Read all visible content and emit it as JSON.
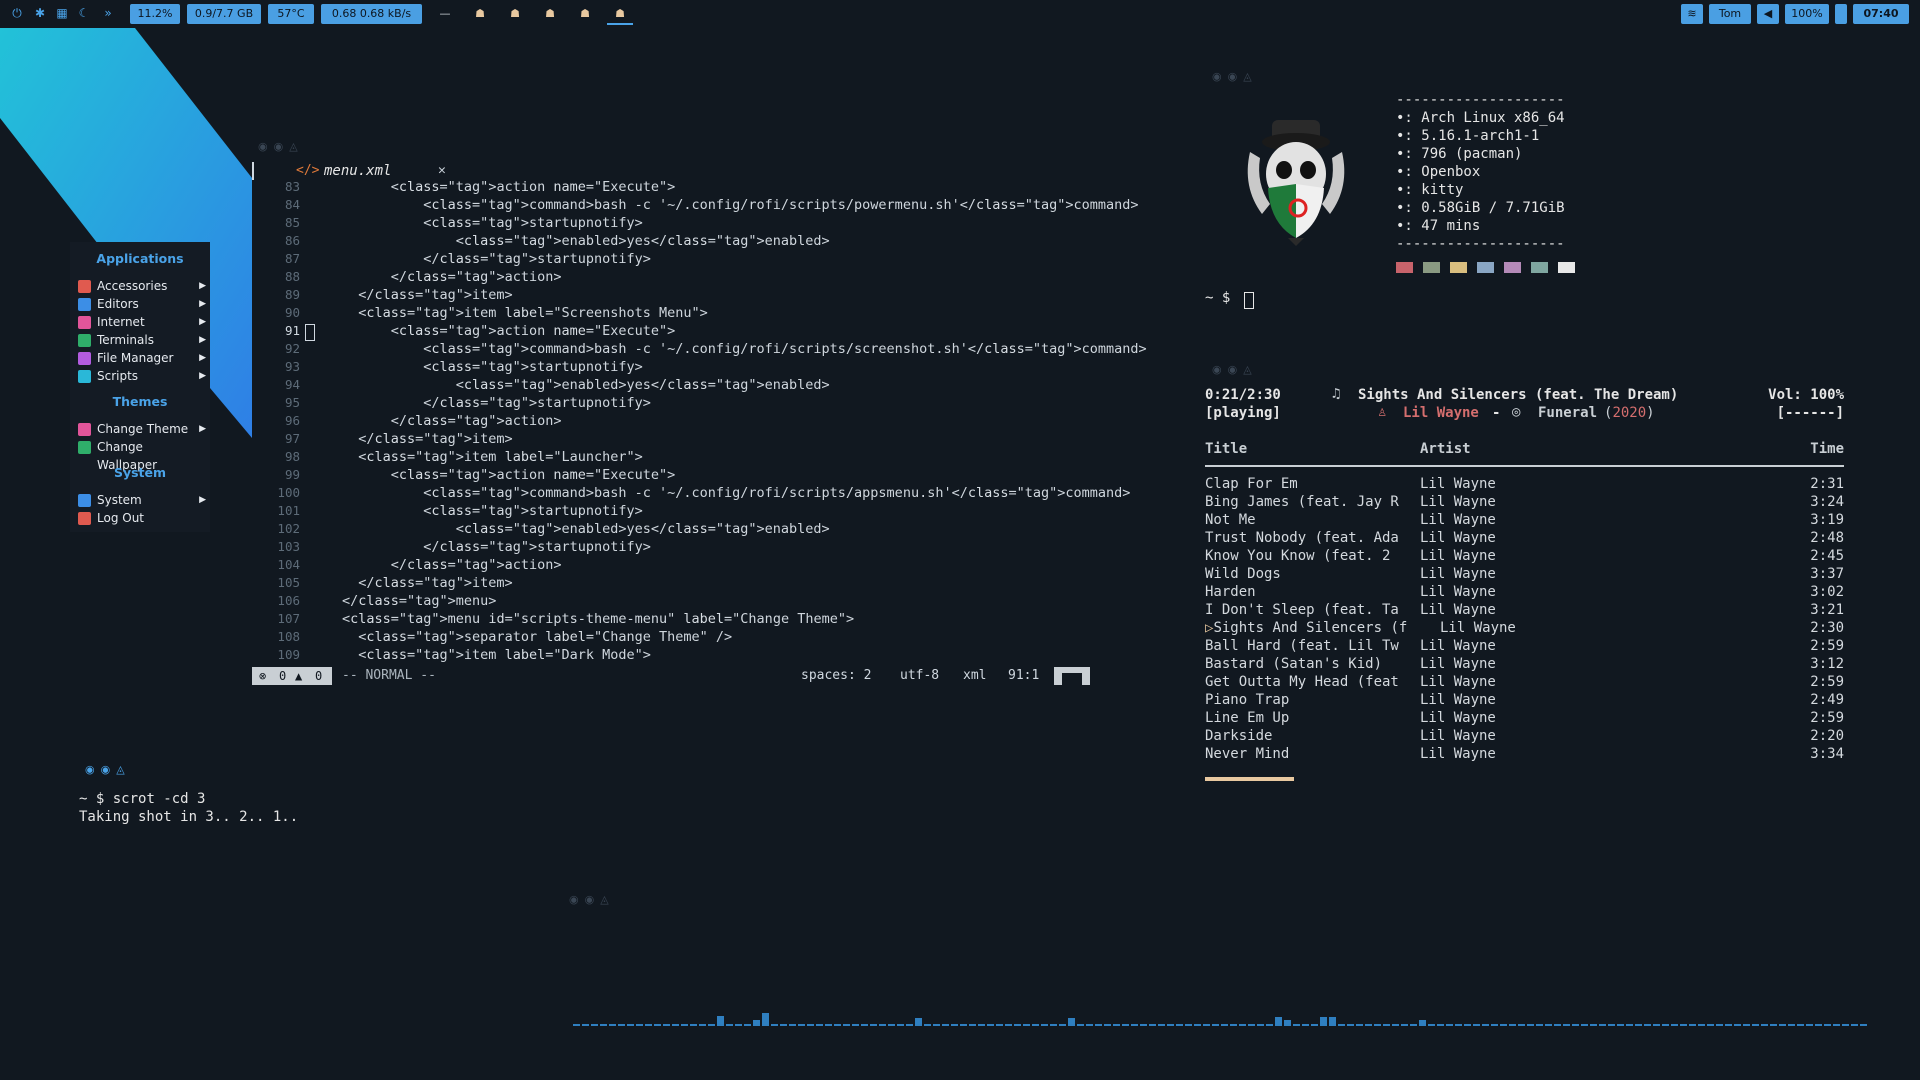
{
  "topbar": {
    "icons": [
      "power-icon",
      "bluetooth-icon",
      "grid-icon",
      "moon-icon",
      "chevrons-icon"
    ],
    "cpu": "11.2%",
    "memory": "0.9/7.7 GB",
    "temperature": "57°C",
    "network": "0.68  0.68 kB/s",
    "workspaces": [
      "—",
      "☗",
      "☗",
      "☗",
      "☗",
      "☗"
    ],
    "active_workspace": 6,
    "user": "Tom",
    "volume": "100%",
    "clock": "07:40"
  },
  "menu": {
    "applications_heading": "Applications",
    "applications": [
      {
        "label": "Accessories",
        "color": "#e05a4f",
        "submenu": true
      },
      {
        "label": "Editors",
        "color": "#3c8ee6",
        "submenu": true
      },
      {
        "label": "Internet",
        "color": "#e2559a",
        "submenu": true
      },
      {
        "label": "Terminals",
        "color": "#2fae6a",
        "submenu": true
      },
      {
        "label": "File Manager",
        "color": "#b35ce0",
        "submenu": true
      },
      {
        "label": "Scripts",
        "color": "#2ab8d8",
        "submenu": true
      }
    ],
    "themes_heading": "Themes",
    "themes": [
      {
        "label": "Change Theme",
        "color": "#e2559a",
        "submenu": true
      },
      {
        "label": "Change Wallpaper",
        "color": "#2fae6a",
        "submenu": false
      }
    ],
    "system_heading": "System",
    "system": [
      {
        "label": "System",
        "color": "#3c8ee6",
        "submenu": true
      },
      {
        "label": "Log Out",
        "color": "#e05a4f",
        "submenu": false
      }
    ]
  },
  "editor": {
    "tab_name": "menu.xml",
    "close": "✕",
    "lines": [
      {
        "n": "83",
        "t": "      <action name=\"Execute\">"
      },
      {
        "n": "84",
        "t": "          <command>bash -c '~/.config/rofi/scripts/powermenu.sh'</command>"
      },
      {
        "n": "85",
        "t": "          <startupnotify>"
      },
      {
        "n": "86",
        "t": "              <enabled>yes</enabled>"
      },
      {
        "n": "87",
        "t": "          </startupnotify>"
      },
      {
        "n": "88",
        "t": "      </action>"
      },
      {
        "n": "89",
        "t": "  </item>"
      },
      {
        "n": "90",
        "t": "  <item label=\"Screenshots Menu\">"
      },
      {
        "n": "91",
        "t": "      <action name=\"Execute\">"
      },
      {
        "n": "92",
        "t": "          <command>bash -c '~/.config/rofi/scripts/screenshot.sh'</command>"
      },
      {
        "n": "93",
        "t": "          <startupnotify>"
      },
      {
        "n": "94",
        "t": "              <enabled>yes</enabled>"
      },
      {
        "n": "95",
        "t": "          </startupnotify>"
      },
      {
        "n": "96",
        "t": "      </action>"
      },
      {
        "n": "97",
        "t": "  </item>"
      },
      {
        "n": "98",
        "t": "  <item label=\"Launcher\">"
      },
      {
        "n": "99",
        "t": "      <action name=\"Execute\">"
      },
      {
        "n": "100",
        "t": "          <command>bash -c '~/.config/rofi/scripts/appsmenu.sh'</command>"
      },
      {
        "n": "101",
        "t": "          <startupnotify>"
      },
      {
        "n": "102",
        "t": "              <enabled>yes</enabled>"
      },
      {
        "n": "103",
        "t": "          </startupnotify>"
      },
      {
        "n": "104",
        "t": "      </action>"
      },
      {
        "n": "105",
        "t": "  </item>"
      },
      {
        "n": "106",
        "t": "</menu>"
      },
      {
        "n": "107",
        "t": "<menu id=\"scripts-theme-menu\" label=\"Change Theme\">"
      },
      {
        "n": "108",
        "t": "  <separator label=\"Change Theme\" />"
      },
      {
        "n": "109",
        "t": "  <item label=\"Dark Mode\">"
      }
    ],
    "status": {
      "errors": "0",
      "warnings": "0",
      "mode": "-- NORMAL --",
      "spaces": "spaces: 2",
      "encoding": "utf-8",
      "filetype": "xml",
      "position": "91:1"
    }
  },
  "neofetch": {
    "separator": "--------------------",
    "lines": [
      "•: Arch Linux x86_64",
      "•: 5.16.1-arch1-1",
      "•: 796 (pacman)",
      "•: Openbox",
      "•: kitty",
      "•: 0.58GiB / 7.71GiB",
      "•: 47 mins"
    ],
    "colors": [
      "#c8636b",
      "#8a9a82",
      "#d9be7f",
      "#8aa6c4",
      "#b48ab8",
      "#7fa6a0",
      "#e8e8e8"
    ],
    "prompt": "~ $"
  },
  "music": {
    "elapsed": "0:21/2:30",
    "state": "[playing]",
    "track": "Sights And Silencers (feat. The Dream)",
    "artist": "Lil Wayne",
    "dash": "-",
    "album": "Funeral",
    "year": "2020",
    "volume": "Vol: 100%",
    "flags": "[------]",
    "progress": 0.14,
    "headers": {
      "title": "Title",
      "artist": "Artist",
      "time": "Time"
    },
    "playing_index": 8,
    "playlist": [
      {
        "title": "Clap For Em",
        "artist": "Lil Wayne",
        "time": "2:31"
      },
      {
        "title": "Bing James (feat. Jay R",
        "artist": "Lil Wayne",
        "time": "3:24"
      },
      {
        "title": "Not Me",
        "artist": "Lil Wayne",
        "time": "3:19"
      },
      {
        "title": "Trust Nobody (feat. Ada",
        "artist": "Lil Wayne",
        "time": "2:48"
      },
      {
        "title": "Know You Know (feat. 2",
        "artist": "Lil Wayne",
        "time": "2:45"
      },
      {
        "title": "Wild Dogs",
        "artist": "Lil Wayne",
        "time": "3:37"
      },
      {
        "title": "Harden",
        "artist": "Lil Wayne",
        "time": "3:02"
      },
      {
        "title": "I Don't Sleep (feat. Ta",
        "artist": "Lil Wayne",
        "time": "3:21"
      },
      {
        "title": "Sights And Silencers (f",
        "artist": "Lil Wayne",
        "time": "2:30"
      },
      {
        "title": "Ball Hard (feat. Lil Tw",
        "artist": "Lil Wayne",
        "time": "2:59"
      },
      {
        "title": "Bastard (Satan's Kid)",
        "artist": "Lil Wayne",
        "time": "3:12"
      },
      {
        "title": "Get Outta My Head (feat",
        "artist": "Lil Wayne",
        "time": "2:59"
      },
      {
        "title": "Piano Trap",
        "artist": "Lil Wayne",
        "time": "2:49"
      },
      {
        "title": "Line Em Up",
        "artist": "Lil Wayne",
        "time": "2:59"
      },
      {
        "title": "Darkside",
        "artist": "Lil Wayne",
        "time": "2:20"
      },
      {
        "title": "Never Mind",
        "artist": "Lil Wayne",
        "time": "3:34"
      }
    ]
  },
  "terminal": {
    "prompt": "~ $",
    "command": "scrot -cd 3",
    "output": "Taking shot in 3.. 2.. 1.."
  },
  "visualizer": {
    "levels": [
      0,
      0,
      0,
      0,
      0,
      0,
      0,
      0,
      0,
      0,
      0,
      0,
      0,
      0,
      0,
      0,
      0.55,
      0,
      0,
      0,
      0.3,
      0.75,
      0,
      0,
      0,
      0,
      0,
      0,
      0,
      0,
      0,
      0,
      0,
      0,
      0,
      0,
      0,
      0,
      0.45,
      0,
      0,
      0,
      0,
      0,
      0,
      0,
      0,
      0,
      0,
      0,
      0,
      0,
      0,
      0,
      0,
      0.45,
      0,
      0,
      0,
      0,
      0,
      0,
      0,
      0,
      0,
      0,
      0,
      0,
      0,
      0,
      0,
      0,
      0,
      0,
      0,
      0,
      0,
      0,
      0.5,
      0.3,
      0,
      0,
      0,
      0.5,
      0.5,
      0,
      0,
      0,
      0,
      0,
      0,
      0,
      0,
      0,
      0.3,
      0,
      0,
      0,
      0,
      0,
      0,
      0,
      0,
      0,
      0,
      0,
      0,
      0,
      0,
      0,
      0,
      0,
      0,
      0,
      0,
      0,
      0,
      0,
      0,
      0,
      0,
      0,
      0,
      0,
      0,
      0,
      0,
      0,
      0,
      0,
      0,
      0,
      0,
      0,
      0,
      0,
      0,
      0,
      0,
      0,
      0,
      0,
      0,
      0,
      0,
      0
    ]
  }
}
